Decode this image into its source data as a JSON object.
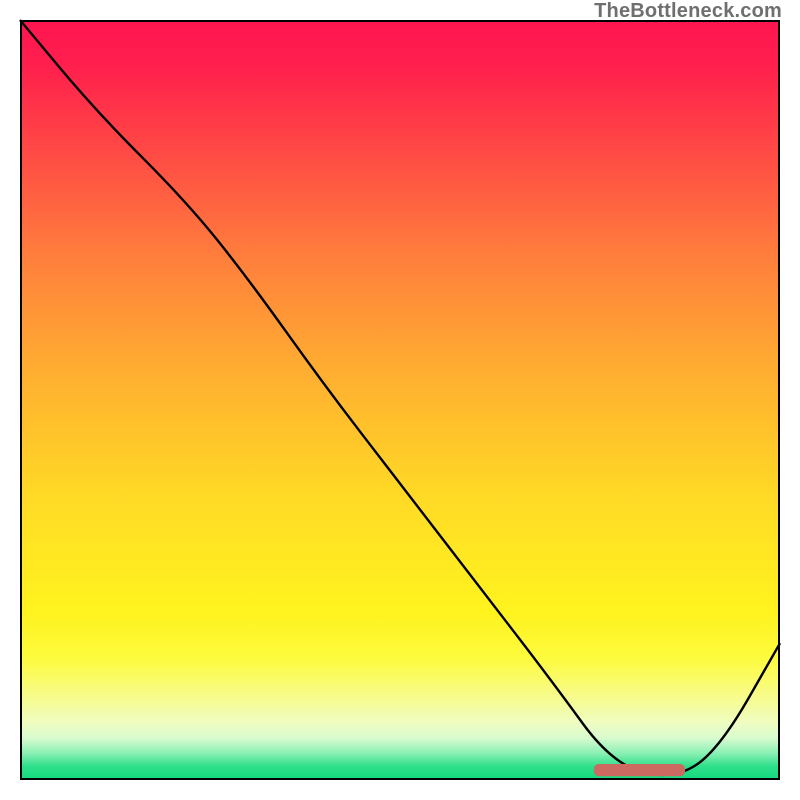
{
  "watermark": "TheBottleneck.com",
  "colors": {
    "curve": "#000000",
    "marker": "#cc6a62",
    "border": "#000000"
  },
  "chart_data": {
    "type": "line",
    "title": "",
    "xlabel": "",
    "ylabel": "",
    "xlim": [
      0,
      100
    ],
    "ylim": [
      0,
      100
    ],
    "grid": false,
    "legend": false,
    "background_gradient": {
      "direction": "vertical",
      "stops": [
        {
          "pct": 0,
          "color": "#ff1550"
        },
        {
          "pct": 50,
          "color": "#ffc22b"
        },
        {
          "pct": 80,
          "color": "#fff520"
        },
        {
          "pct": 100,
          "color": "#12d97d"
        }
      ]
    },
    "series": [
      {
        "name": "bottleneck-curve",
        "x": [
          0,
          10,
          22,
          30,
          40,
          50,
          60,
          70,
          78,
          86,
          92,
          100
        ],
        "y": [
          100,
          88,
          76,
          66,
          52,
          39,
          26,
          13,
          2,
          0,
          4,
          18
        ]
      }
    ],
    "annotations": [
      {
        "name": "minimum-band",
        "shape": "rounded-rect",
        "x_range": [
          75.5,
          87.5
        ],
        "y": 0.5,
        "height": 1.6,
        "color": "#cc6a62"
      }
    ]
  }
}
